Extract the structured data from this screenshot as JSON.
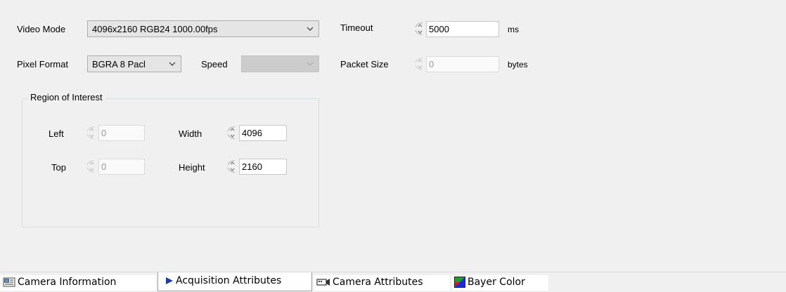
{
  "form": {
    "video_mode_label": "Video Mode",
    "video_mode_value": "4096x2160 RGB24 1000.00fps",
    "pixel_format_label": "Pixel Format",
    "pixel_format_value": "BGRA 8 Pacl",
    "speed_label": "Speed",
    "speed_value": "",
    "timeout_label": "Timeout",
    "timeout_value": "5000",
    "timeout_unit": "ms",
    "packet_size_label": "Packet Size",
    "packet_size_value": "0",
    "packet_size_unit": "bytes"
  },
  "roi": {
    "title": "Region of Interest",
    "left_label": "Left",
    "left_value": "0",
    "top_label": "Top",
    "top_value": "0",
    "width_label": "Width",
    "width_value": "4096",
    "height_label": "Height",
    "height_value": "2160"
  },
  "tabs": [
    {
      "label": "Camera Information",
      "icon": "camera-info-icon"
    },
    {
      "label": "Acquisition Attributes",
      "icon": "play-arrow-icon",
      "active": true
    },
    {
      "label": "Camera Attributes",
      "icon": "camera-icon"
    },
    {
      "label": "Bayer Color",
      "icon": "bayer-color-icon"
    }
  ]
}
